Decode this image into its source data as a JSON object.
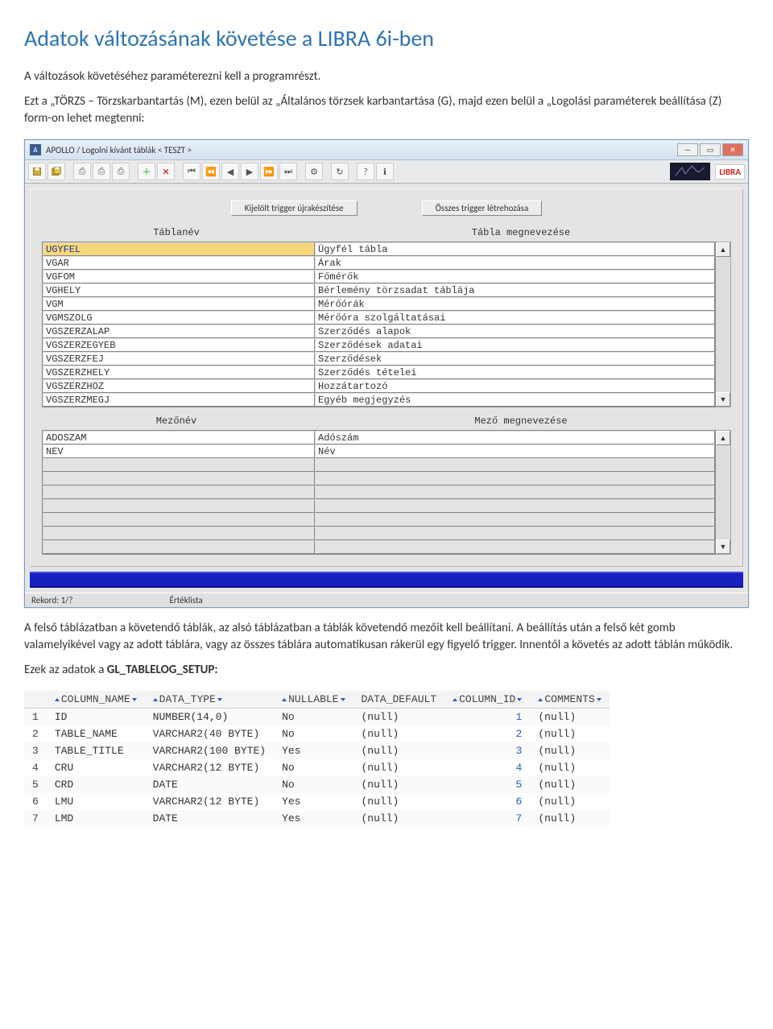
{
  "doc": {
    "title": "Adatok változásának követése a LIBRA 6i-ben",
    "p1": "A változások követéséhez paraméterezni kell a programrészt.",
    "p2a": "Ezt a „TÖRZS – Törzskarbantartás (M), ezen belül az „Általános törzsek karbantartása (G), majd ezen belül a „Logolási paraméterek beállítása (Z) form-on lehet megtenni:",
    "p3": "A felső táblázatban a követendő táblák, az alsó táblázatban a táblák követendő mezőit kell beállítani. A beállítás után a felső két gomb valamelyikével vagy az adott táblára, vagy az összes táblára automatikusan rákerül egy figyelő trigger. Innentől a követés az adott táblán működik.",
    "p4a": "Ezek az adatok a ",
    "p4b": "GL_TABLELOG_SETUP:",
    "win_title": "APOLLO / Logolni kívánt táblák  < TESZT >",
    "logo_text": "LIBRA",
    "btn1": "Kijelölt trigger újrakészítése",
    "btn2": "Összes trigger létrehozása",
    "hdr_table": "Táblanév",
    "hdr_table_desc": "Tábla megnevezése",
    "hdr_field": "Mezőnév",
    "hdr_field_desc": "Mező megnevezése",
    "status_record": "Rekord: 1/?",
    "status_list": "Értéklista"
  },
  "tables": [
    {
      "name": "UGYFEL",
      "desc": "Ügyfél tábla"
    },
    {
      "name": "VGAR",
      "desc": "Árak"
    },
    {
      "name": "VGFOM",
      "desc": "Főmérők"
    },
    {
      "name": "VGHELY",
      "desc": "Bérlemény törzsadat táblája"
    },
    {
      "name": "VGM",
      "desc": "Mérőórák"
    },
    {
      "name": "VGMSZOLG",
      "desc": "Mérőóra szolgáltatásai"
    },
    {
      "name": "VGSZERZALAP",
      "desc": "Szerződés alapok"
    },
    {
      "name": "VGSZERZEGYEB",
      "desc": "Szerződések adatai"
    },
    {
      "name": "VGSZERZFEJ",
      "desc": "Szerződések"
    },
    {
      "name": "VGSZERZHELY",
      "desc": "Szerződés tételei"
    },
    {
      "name": "VGSZERZHOZ",
      "desc": "Hozzátartozó"
    },
    {
      "name": "VGSZERZMEGJ",
      "desc": "Egyéb megjegyzés"
    }
  ],
  "fields": [
    {
      "name": "ADOSZAM",
      "desc": "Adószám"
    },
    {
      "name": "NEV",
      "desc": "Név"
    }
  ],
  "schema": {
    "cols": [
      "",
      "COLUMN_NAME",
      "DATA_TYPE",
      "NULLABLE",
      "DATA_DEFAULT",
      "COLUMN_ID",
      "COMMENTS"
    ],
    "rows": [
      {
        "n": "1",
        "name": "ID",
        "type": "NUMBER(14,0)",
        "null": "No",
        "def": "(null)",
        "id": "1",
        "comm": "(null)"
      },
      {
        "n": "2",
        "name": "TABLE_NAME",
        "type": "VARCHAR2(40 BYTE)",
        "null": "No",
        "def": "(null)",
        "id": "2",
        "comm": "(null)"
      },
      {
        "n": "3",
        "name": "TABLE_TITLE",
        "type": "VARCHAR2(100 BYTE)",
        "null": "Yes",
        "def": "(null)",
        "id": "3",
        "comm": "(null)"
      },
      {
        "n": "4",
        "name": "CRU",
        "type": "VARCHAR2(12 BYTE)",
        "null": "No",
        "def": "(null)",
        "id": "4",
        "comm": "(null)"
      },
      {
        "n": "5",
        "name": "CRD",
        "type": "DATE",
        "null": "No",
        "def": "(null)",
        "id": "5",
        "comm": "(null)"
      },
      {
        "n": "6",
        "name": "LMU",
        "type": "VARCHAR2(12 BYTE)",
        "null": "Yes",
        "def": "(null)",
        "id": "6",
        "comm": "(null)"
      },
      {
        "n": "7",
        "name": "LMD",
        "type": "DATE",
        "null": "Yes",
        "def": "(null)",
        "id": "7",
        "comm": "(null)"
      }
    ]
  }
}
